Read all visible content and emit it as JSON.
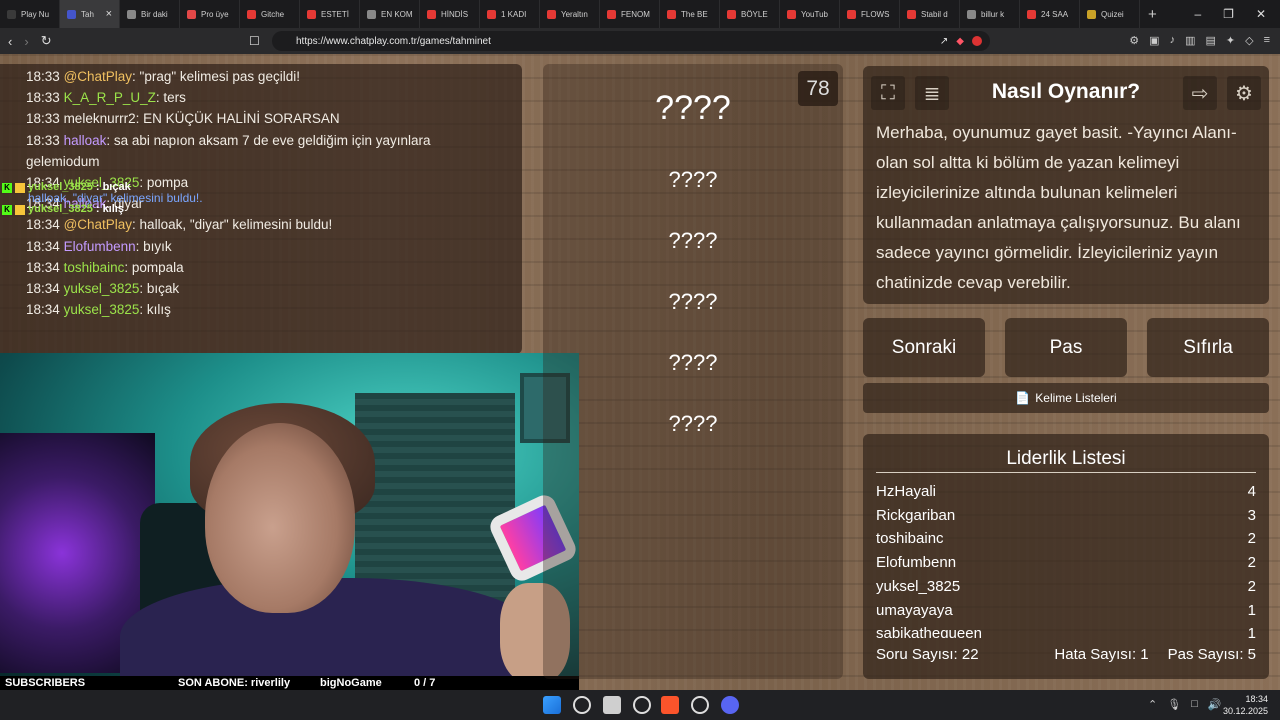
{
  "browser": {
    "tabs": [
      {
        "label": "Play Nu",
        "color": "#3a3a3a"
      },
      {
        "label": "Tah",
        "color": "#4455cc",
        "active": true
      },
      {
        "label": "Bir daki",
        "color": "#888888"
      },
      {
        "label": "Pro üye",
        "color": "#e34848"
      },
      {
        "label": "Gitche",
        "color": "#e53935"
      },
      {
        "label": "ESTETİ",
        "color": "#e53935"
      },
      {
        "label": "EN KOM",
        "color": "#888888"
      },
      {
        "label": "HİNDİS",
        "color": "#e53935"
      },
      {
        "label": "1 KADI",
        "color": "#e53935"
      },
      {
        "label": "Yeraltın",
        "color": "#e53935"
      },
      {
        "label": "FENOM",
        "color": "#e53935"
      },
      {
        "label": "The BE",
        "color": "#e53935"
      },
      {
        "label": "BÖYLE",
        "color": "#e53935"
      },
      {
        "label": "YouTub",
        "color": "#e53935"
      },
      {
        "label": "FLOWS",
        "color": "#e53935"
      },
      {
        "label": "Stabil d",
        "color": "#e53935"
      },
      {
        "label": "billur k",
        "color": "#888888"
      },
      {
        "label": "24 SAA",
        "color": "#e53935"
      },
      {
        "label": "Quizei",
        "color": "#c9a227"
      }
    ],
    "new_tab": "+",
    "url": "https://www.chatplay.com.tr/games/tahminet"
  },
  "chat": {
    "lines": [
      {
        "time": "18:33",
        "user": "@ChatPlay",
        "color": "#f0c060",
        "msg": ": \"prag\" kelimesi pas geçildi!"
      },
      {
        "time": "18:33",
        "user": "K_A_R_P_U_Z",
        "color": "#9be34a",
        "msg": ": ters"
      },
      {
        "time": "18:33",
        "user": "meleknurrr2",
        "color": "#f1ece4",
        "msg": ": EN KÜÇÜK HALİNİ SORARSAN"
      },
      {
        "time": "18:33",
        "user": "halloak",
        "color": "#c49bff",
        "msg": ": sa abi napıon aksam 7 de eve geldiğim için yayınlara gelemiodum"
      },
      {
        "time": "18:34",
        "user": "yuksel_3825",
        "color": "#9be34a",
        "msg": ": pompa"
      },
      {
        "time": "18:34",
        "user": "halloak",
        "color": "#c49bff",
        "msg": ": diyar"
      },
      {
        "time": "18:34",
        "user": "@ChatPlay",
        "color": "#f0c060",
        "msg": ": halloak, \"diyar\" kelimesini buldu!"
      },
      {
        "time": "18:34",
        "user": "Elofumbenn",
        "color": "#c49bff",
        "msg": ": bıyık"
      },
      {
        "time": "18:34",
        "user": "toshibainc",
        "color": "#9be34a",
        "msg": ": pompala"
      },
      {
        "time": "18:34",
        "user": "yuksel_3825",
        "color": "#9be34a",
        "msg": ": bıçak"
      },
      {
        "time": "18:34",
        "user": "yuksel_3825",
        "color": "#9be34a",
        "msg": ": kılış"
      }
    ],
    "overlay": [
      {
        "user": "yuksel_3825",
        "msg": ": bıçak",
        "color": "#9be34a"
      },
      {
        "user": "yuksel_3825",
        "msg": ": kılış",
        "color": "#9be34a"
      }
    ],
    "overlay_ghost": "halloak, \"diyar\" kelimesini buldu!."
  },
  "stream_bar": {
    "subscribers": "SUBSCRIBERS",
    "son_abone": "SON ABONE: riverlily",
    "brand": "bigNoGame",
    "count": "0 / 7"
  },
  "game": {
    "question_count": "78",
    "words": [
      "????",
      "????",
      "????",
      "????",
      "????",
      "????"
    ]
  },
  "howto": {
    "title": "Nasıl Oynanır?",
    "body": "Merhaba, oyunumuz gayet basit. -Yayıncı Alanı- olan sol altta ki bölüm de yazan kelimeyi izleyicilerinize altında bulunan kelimeleri kullanmadan anlatmaya çalışıyorsunuz. Bu alanı sadece yayıncı görmelidir. İzleyicileriniz yayın chatinizde cevap verebilir."
  },
  "buttons": {
    "next": "Sonraki",
    "pass": "Pas",
    "reset": "Sıfırla",
    "word_lists": "Kelime Listeleri"
  },
  "leaderboard": {
    "title": "Liderlik Listesi",
    "rows": [
      {
        "name": "HzHayali",
        "score": "4"
      },
      {
        "name": "Rickgariban",
        "score": "3"
      },
      {
        "name": "toshibainc",
        "score": "2"
      },
      {
        "name": "Elofumbenn",
        "score": "2"
      },
      {
        "name": "yuksel_3825",
        "score": "2"
      },
      {
        "name": "umayayaya",
        "score": "1"
      },
      {
        "name": "sabikathequeen",
        "score": "1"
      }
    ],
    "questions": "Soru Sayısı: 22",
    "errors": "Hata Sayısı: 1",
    "passes": "Pas Sayısı: 5"
  },
  "taskbar": {
    "time": "18:34",
    "date": "30.12.2025"
  }
}
